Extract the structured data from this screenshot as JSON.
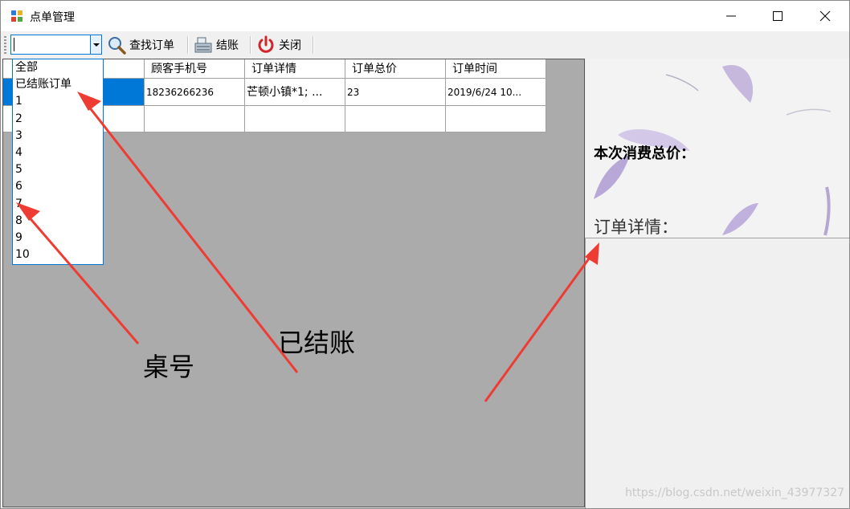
{
  "window": {
    "title": "点单管理"
  },
  "toolbar": {
    "table_combo_value": "",
    "search_label": "查找订单",
    "checkout_label": "结账",
    "close_label": "关闭"
  },
  "dropdown": {
    "options": [
      "全部",
      "已结账订单",
      "1",
      "2",
      "3",
      "4",
      "5",
      "6",
      "7",
      "8",
      "9",
      "10"
    ]
  },
  "grid": {
    "columns": [
      "",
      "顾客手机号",
      "订单详情",
      "订单总价",
      "订单时间"
    ],
    "rows": [
      [
        "",
        "18236266236",
        "芒顿小镇*1; ...",
        "23",
        "2019/6/24 10..."
      ],
      [
        "",
        "",
        "",
        "",
        ""
      ]
    ]
  },
  "side": {
    "total_label": "本次消费总价：",
    "detail_label": "订单详情："
  },
  "annotations": {
    "table_no": "桌号",
    "checked_out": "已结账"
  },
  "watermark": "https://blog.csdn.net/weixin_43977327",
  "colors": {
    "accent": "#0078d7",
    "grid_bg": "#ababab",
    "arrow": "#ee3b33"
  }
}
